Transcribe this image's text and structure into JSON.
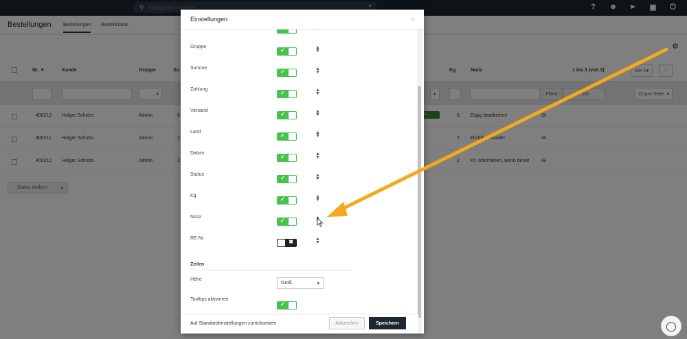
{
  "topbar": {
    "search_placeholder": "Kategorien / Artikel"
  },
  "header": {
    "title": "Bestellungen",
    "tabs": [
      "Bestellungen",
      "Bestellstatus"
    ]
  },
  "table": {
    "columns": {
      "nr": "Nr.",
      "kunde": "Kunde",
      "gruppe": "Gruppe",
      "summe": "Su",
      "kg": "Kg",
      "notiz": "Notiz"
    },
    "pager_text": "1 bis 3 (von 3)",
    "page_select": "von 1",
    "filter_btn": "Filtern",
    "reset_btn": "...zen",
    "per_page": "20 pro Seite",
    "rows": [
      {
        "nr": "400212",
        "kunde": "Holger Schrörs",
        "gruppe": "Admin",
        "summe": "6",
        "status": "onl...",
        "kg": "6",
        "notiz": "Zügig bearbeiten!"
      },
      {
        "nr": "400211",
        "kunde": "Holger Schrörs",
        "gruppe": "Admin",
        "summe": "2",
        "kg": "2",
        "notiz": "Wichtige Kunde!"
      },
      {
        "nr": "400210",
        "kunde": "Holger Schrörs",
        "gruppe": "Admin",
        "summe": "2",
        "kg": "2",
        "notiz": "XY informieren, wenn bereit"
      }
    ],
    "status_change_label": "Status ändern"
  },
  "modal": {
    "title": "Einstellungen",
    "close": "×",
    "settings": [
      {
        "label": "Gruppe",
        "on": true
      },
      {
        "label": "Summe",
        "on": true
      },
      {
        "label": "Zahlung",
        "on": true
      },
      {
        "label": "Versand",
        "on": true
      },
      {
        "label": "Land",
        "on": true
      },
      {
        "label": "Datum",
        "on": true
      },
      {
        "label": "Status",
        "on": true
      },
      {
        "label": "Kg",
        "on": true
      },
      {
        "label": "Notiz",
        "on": true
      },
      {
        "label": "RE-Nr.",
        "on": false
      }
    ],
    "rows_section": "Zeilen",
    "height_label": "Höhe",
    "height_value": "Groß",
    "tooltips_label": "Tooltips aktivieren",
    "reset_label": "Auf Standardeinstellungen zurücksetzen",
    "cancel_label": "Abbrechen",
    "save_label": "Speichern"
  },
  "colors": {
    "toggle_on": "#46c24f",
    "toggle_off": "#222222",
    "annotation_arrow": "#f4a81d",
    "topbar": "#1c2731"
  },
  "icons": [
    "search-icon",
    "help-icon",
    "users-icon",
    "megaphone-icon",
    "cart-icon",
    "power-icon",
    "gears-icon",
    "mail-icon",
    "lightbulb-icon"
  ]
}
